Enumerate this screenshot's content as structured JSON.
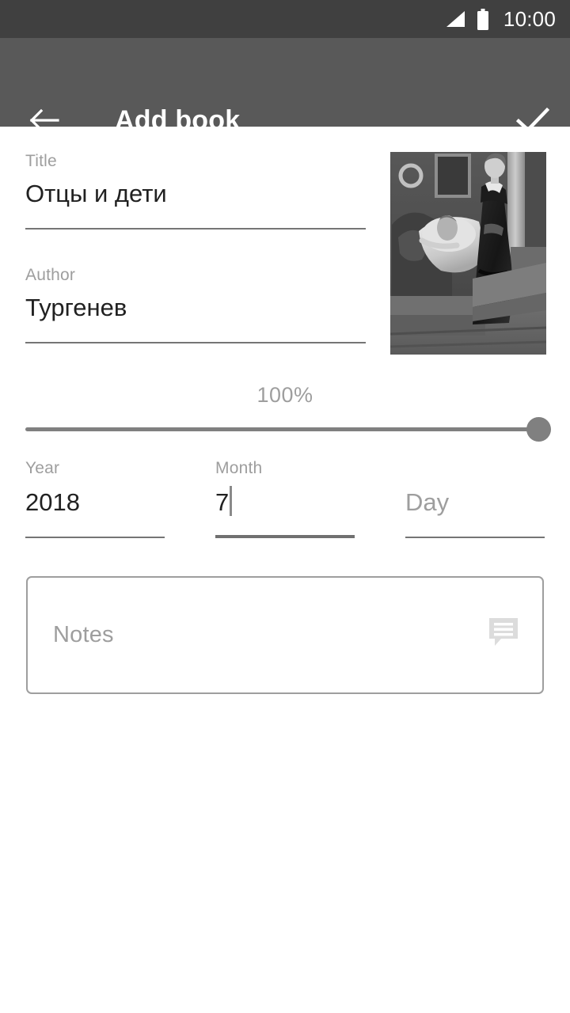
{
  "status_bar": {
    "time": "10:00",
    "signal_icon": "signal-triangle-icon",
    "battery_icon": "battery-full-icon",
    "background_color": "#404040"
  },
  "app_bar": {
    "title": "Add book",
    "back_icon": "arrow-left-icon",
    "confirm_icon": "check-icon",
    "background_color": "#595959"
  },
  "form": {
    "title_field": {
      "label": "Title",
      "value": "Отцы и дети"
    },
    "author_field": {
      "label": "Author",
      "value": "Тургенев"
    },
    "cover": {
      "alt": "book-cover-painting"
    },
    "progress_slider": {
      "value_label": "100%",
      "percent": 100,
      "min": 0,
      "max": 100,
      "track_color": "#808080"
    },
    "year_field": {
      "label": "Year",
      "value": "2018"
    },
    "month_field": {
      "label": "Month",
      "value": "7",
      "focused": true
    },
    "day_field": {
      "label": "",
      "placeholder": "Day",
      "value": ""
    },
    "notes_field": {
      "placeholder": "Notes",
      "value": "",
      "icon": "comment-icon"
    }
  },
  "colors": {
    "label_gray": "#9e9e9e",
    "text_dark": "#212121",
    "underline": "#757575",
    "page_background": "#ffffff"
  }
}
